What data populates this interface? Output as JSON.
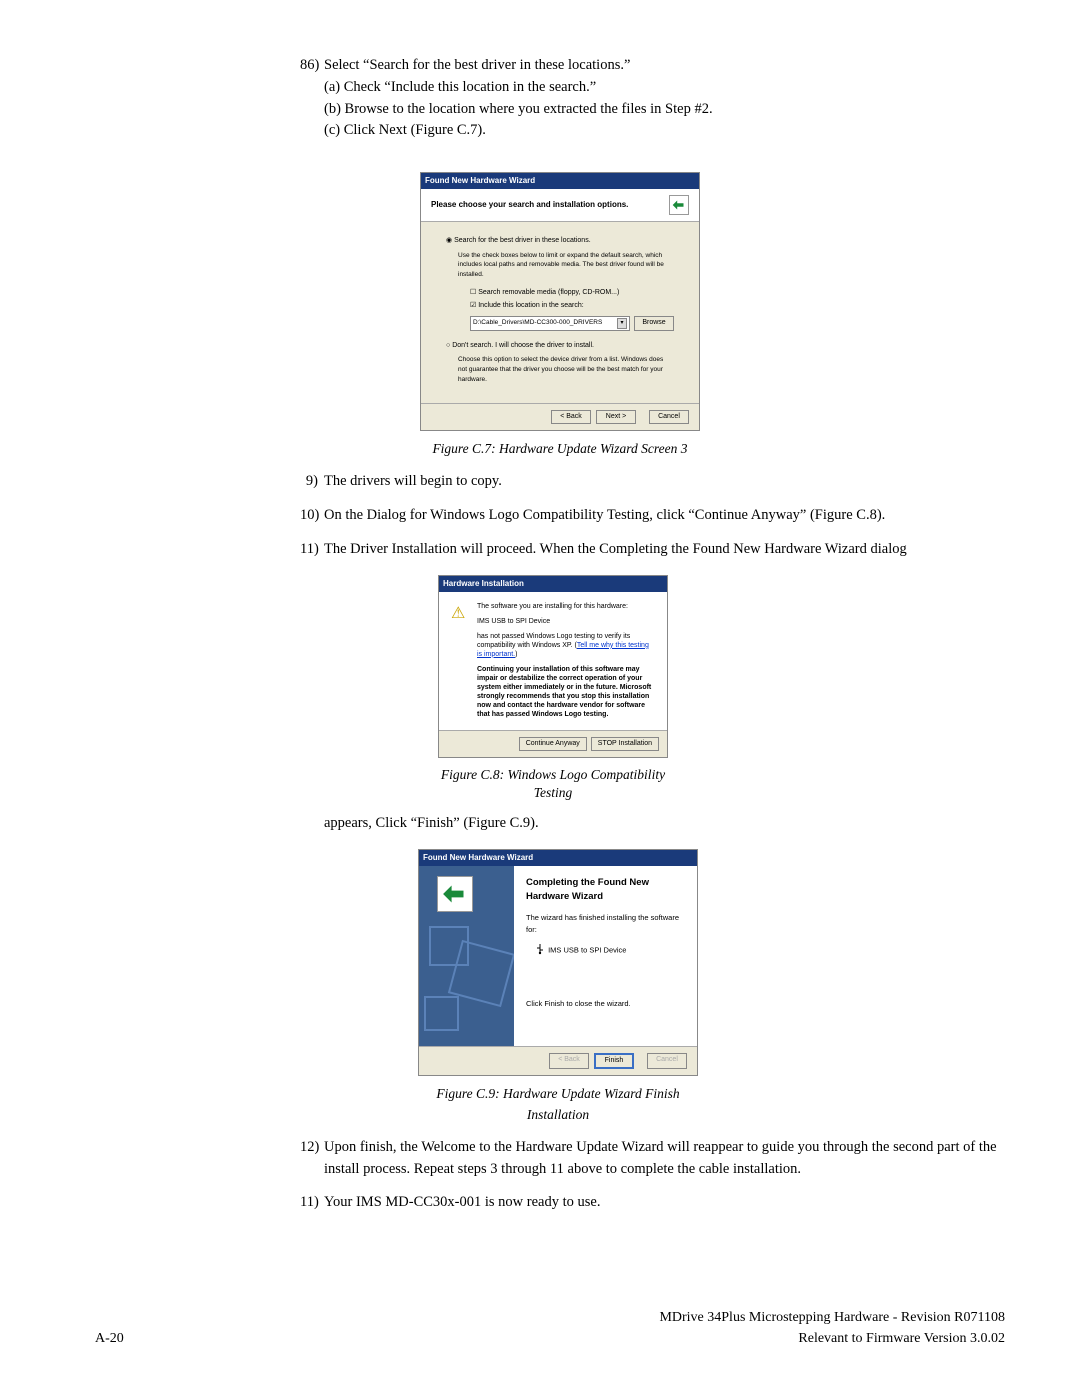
{
  "steps": {
    "s86": {
      "num": "86)",
      "text": "Select “Search for the best driver in these locations.”",
      "a": "(a) Check “Include this location in the search.”",
      "b": "(b) Browse to the location where you extracted the files in Step #2.",
      "c": "(c) Click Next (Figure C.7)."
    },
    "s9": {
      "num": "9)",
      "text": "The drivers will begin to copy."
    },
    "s10": {
      "num": "10)",
      "text": "On the Dialog for Windows Logo Compatibility Testing, click “Continue Anyway” (Figure C.8)."
    },
    "s11a": {
      "num": "11)",
      "text": "The Driver Installation will proceed. When the Completing the Found New Hardware Wizard dialog"
    },
    "s11cont": "appears, Click “Finish” (Figure C.9).",
    "s12": {
      "num": "12)",
      "text": "Upon finish, the Welcome to the Hardware Update Wizard will reappear to guide you through the second part of the install process. Repeat steps 3 through 11 above to complete the cable installation."
    },
    "s11b": {
      "num": "11)",
      "text": "Your IMS MD-CC30x-001 is now ready to use."
    }
  },
  "figC7": {
    "titlebar": "Found New Hardware Wizard",
    "banner": "Please choose your search and installation options.",
    "radio1": "Search for the best driver in these locations.",
    "hint1": "Use the check boxes below to limit or expand the default search, which includes local paths and removable media. The best driver found will be installed.",
    "check1": "Search removable media (floppy, CD-ROM...)",
    "check2": "Include this location in the search:",
    "path": "D:\\Cable_Drivers\\MD-CC300-000_DRIVERS",
    "browse": "Browse",
    "radio2": "Don't search. I will choose the driver to install.",
    "hint2": "Choose this option to select the device driver from a list. Windows does not guarantee that the driver you choose will be the best match for your hardware.",
    "back": "< Back",
    "next": "Next >",
    "cancel": "Cancel",
    "caption": "Figure C.7: Hardware Update Wizard Screen 3"
  },
  "figC8": {
    "title": "Hardware Installation",
    "line1": "The software you are installing for this hardware:",
    "device": "IMS USB to SPI Device",
    "line2a": "has not passed Windows Logo testing to verify its compatibility with Windows XP. (",
    "link": "Tell me why this testing is important.",
    "line2b": ")",
    "bold": "Continuing your installation of this software may impair or destabilize the correct operation of your system either immediately or in the future. Microsoft strongly recommends that you stop this installation now and contact the hardware vendor for software that has passed Windows Logo testing.",
    "continue": "Continue Anyway",
    "stop": "STOP Installation",
    "captionA": "Figure C.8: Windows Logo Compatibility",
    "captionB": "Testing"
  },
  "figC9": {
    "titlebar": "Found New Hardware Wizard",
    "heading": "Completing the Found New Hardware Wizard",
    "line1": "The wizard has finished installing the software for:",
    "device": "IMS USB to SPI Device",
    "line2": "Click Finish to close the wizard.",
    "back": "< Back",
    "finish": "Finish",
    "cancel": "Cancel",
    "caption": "Figure C.9: Hardware Update Wizard Finish Installation"
  },
  "footer": {
    "page": "A-20",
    "line1": "MDrive 34Plus Microstepping Hardware - Revision R071108",
    "line2": "Relevant to Firmware Version 3.0.02"
  }
}
